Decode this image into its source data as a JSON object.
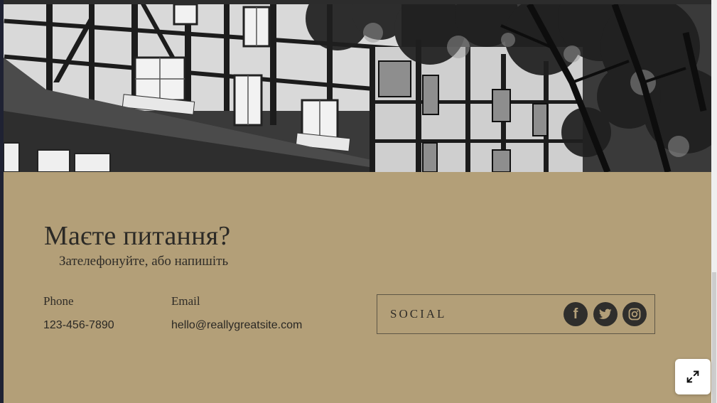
{
  "contact": {
    "title": "Маєте питання?",
    "subtitle": "Зателефонуйте, або напишіть",
    "phone_label": "Phone",
    "phone_value": "123-456-7890",
    "email_label": "Email",
    "email_value": "hello@reallygreatsite.com"
  },
  "social": {
    "label": "SOCIAL",
    "icons": [
      "facebook-icon",
      "twitter-icon",
      "instagram-icon"
    ]
  },
  "colors": {
    "background": "#b39f78",
    "text": "#2c2a26",
    "icon_bg": "#2f2e2c"
  },
  "controls": {
    "expand_icon": "expand-icon"
  }
}
